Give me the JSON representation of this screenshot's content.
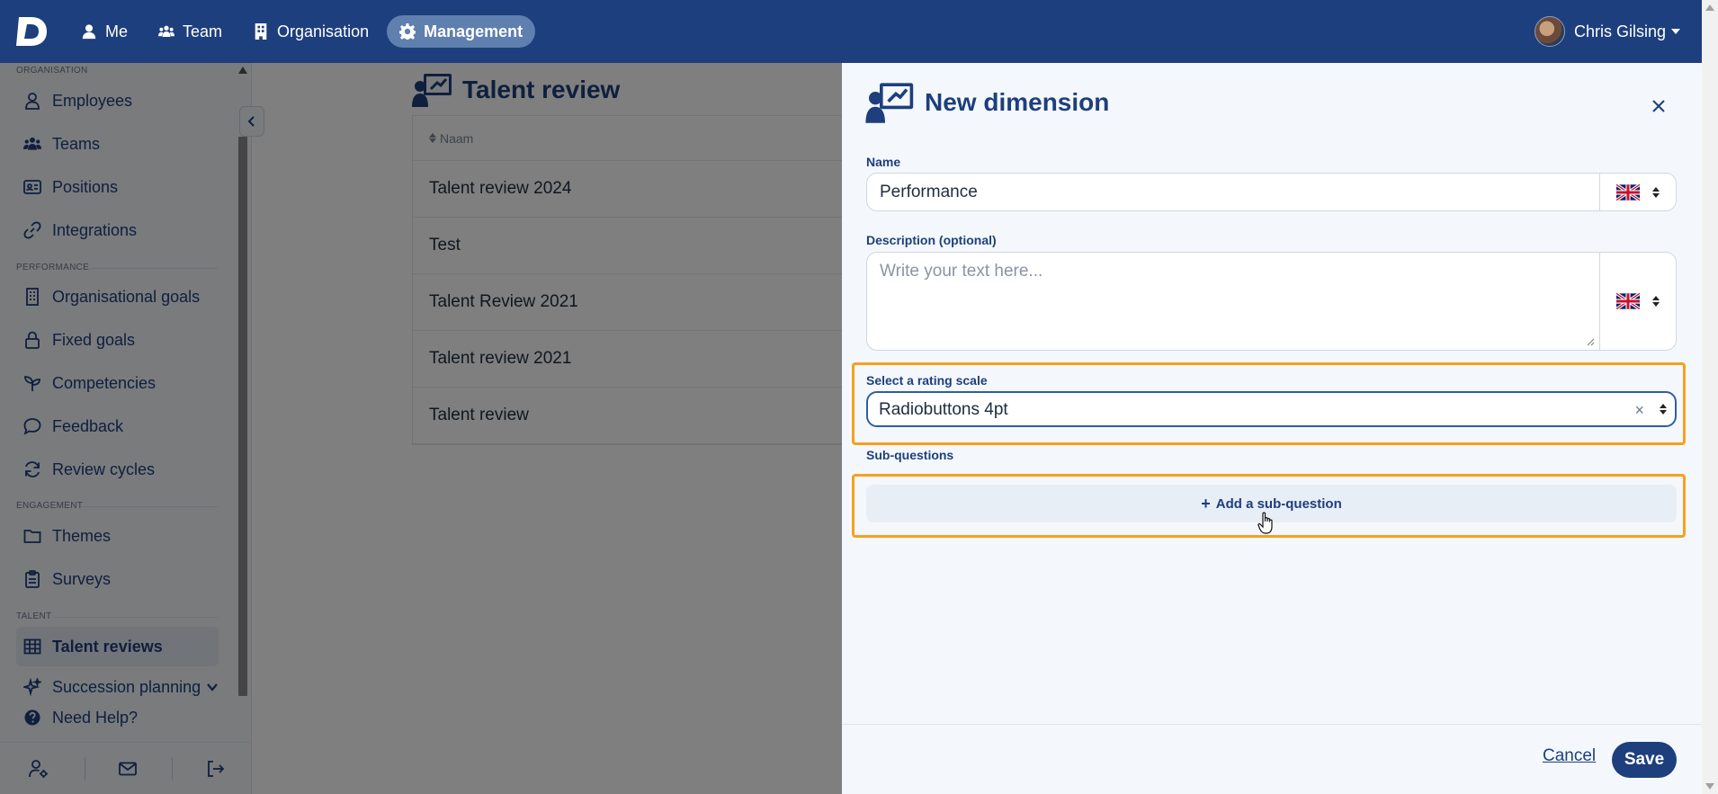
{
  "app": {
    "logo_letter": "D"
  },
  "nav": {
    "items": [
      {
        "label": "Me",
        "icon": "user-icon"
      },
      {
        "label": "Team",
        "icon": "users-icon"
      },
      {
        "label": "Organisation",
        "icon": "building-icon"
      },
      {
        "label": "Management",
        "icon": "gear-icon",
        "active": true
      }
    ],
    "user_name": "Chris Gilsing"
  },
  "sidebar": {
    "sections": {
      "organisation": "ORGANISATION",
      "performance": "PERFORMANCE",
      "engagement": "ENGAGEMENT",
      "talent": "TALENT"
    },
    "items": [
      {
        "label": "Employees",
        "icon": "person-icon"
      },
      {
        "label": "Teams",
        "icon": "users-icon"
      },
      {
        "label": "Positions",
        "icon": "id-card-icon"
      },
      {
        "label": "Integrations",
        "icon": "link-icon"
      },
      {
        "label": "Organisational goals",
        "icon": "building-icon"
      },
      {
        "label": "Fixed goals",
        "icon": "lock-icon"
      },
      {
        "label": "Competencies",
        "icon": "sprout-icon"
      },
      {
        "label": "Feedback",
        "icon": "chat-icon"
      },
      {
        "label": "Review cycles",
        "icon": "refresh-icon"
      },
      {
        "label": "Themes",
        "icon": "folder-icon"
      },
      {
        "label": "Surveys",
        "icon": "clipboard-icon"
      },
      {
        "label": "Talent reviews",
        "icon": "grid-icon",
        "active": true
      },
      {
        "label": "Succession planning",
        "icon": "sparkle-icon"
      }
    ],
    "help": "Need Help?"
  },
  "main": {
    "title": "Talent review",
    "column_header": "Naam",
    "rows": [
      "Talent review 2024",
      "Test",
      "Talent Review 2021",
      "Talent review 2021",
      "Talent review"
    ]
  },
  "panel": {
    "title": "New dimension",
    "name_label": "Name",
    "name_value": "Performance",
    "description_label": "Description (optional)",
    "description_placeholder": "Write your text here...",
    "rating_label": "Select a rating scale",
    "rating_value": "Radiobuttons 4pt",
    "clear_symbol": "×",
    "subquestions_label": "Sub-questions",
    "add_subquestion": "Add a sub-question",
    "add_symbol": "+",
    "cancel": "Cancel",
    "save": "Save"
  },
  "colors": {
    "navbar": "#1e3f7d",
    "nav_active": "#5f7fae",
    "highlight": "#f5a020",
    "panel_bg": "#f4f8fc",
    "button_primary": "#1e3f7d"
  }
}
